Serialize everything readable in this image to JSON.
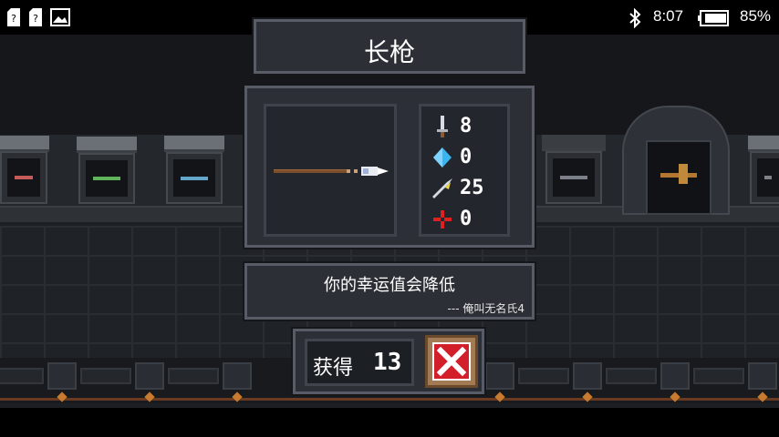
{
  "statusbar": {
    "time": "8:07",
    "battery": "85%",
    "left_icons": [
      "sim-unknown-icon",
      "sim-unknown-icon",
      "image-icon"
    ],
    "right_icons": [
      "bluetooth-icon",
      "battery-icon"
    ]
  },
  "dialog": {
    "weapon_name": "长枪",
    "weapon_icon": "spear-icon",
    "stats": [
      {
        "icon": "sword-damage-icon",
        "value": "8"
      },
      {
        "icon": "energy-crystal-icon",
        "value": "0"
      },
      {
        "icon": "critical-chance-icon",
        "value": "25"
      },
      {
        "icon": "accuracy-crosshair-icon",
        "value": "0"
      }
    ],
    "quote": "你的幸运值会降低",
    "quote_author": "--- 俺叫无名氏4",
    "obtain_label": "获得",
    "obtain_count": "13",
    "close_icon": "close-x-icon"
  },
  "colors": {
    "panel_bg": "#2c2f36",
    "panel_border": "#575c66",
    "close_red": "#d21f2a",
    "close_frame": "#a27b55"
  }
}
